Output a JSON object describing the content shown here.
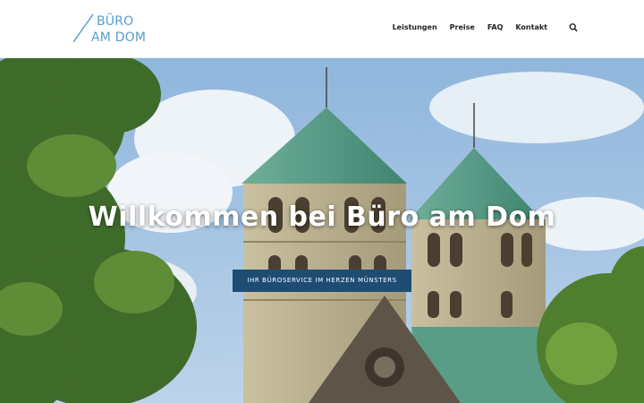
{
  "brand": {
    "logo_line1": "BÜRO",
    "logo_line2": "AM DOM",
    "color": "#5a9ec9"
  },
  "nav": {
    "items": [
      {
        "label": "Leistungen"
      },
      {
        "label": "Preise"
      },
      {
        "label": "FAQ"
      },
      {
        "label": "Kontakt"
      }
    ],
    "search_icon": "search-icon"
  },
  "hero": {
    "title": "Willkommen bei Büro am Dom",
    "button_label": "IHR BÜROSERVICE IM HERZEN MÜNSTERS",
    "button_color": "#1e4d74"
  }
}
